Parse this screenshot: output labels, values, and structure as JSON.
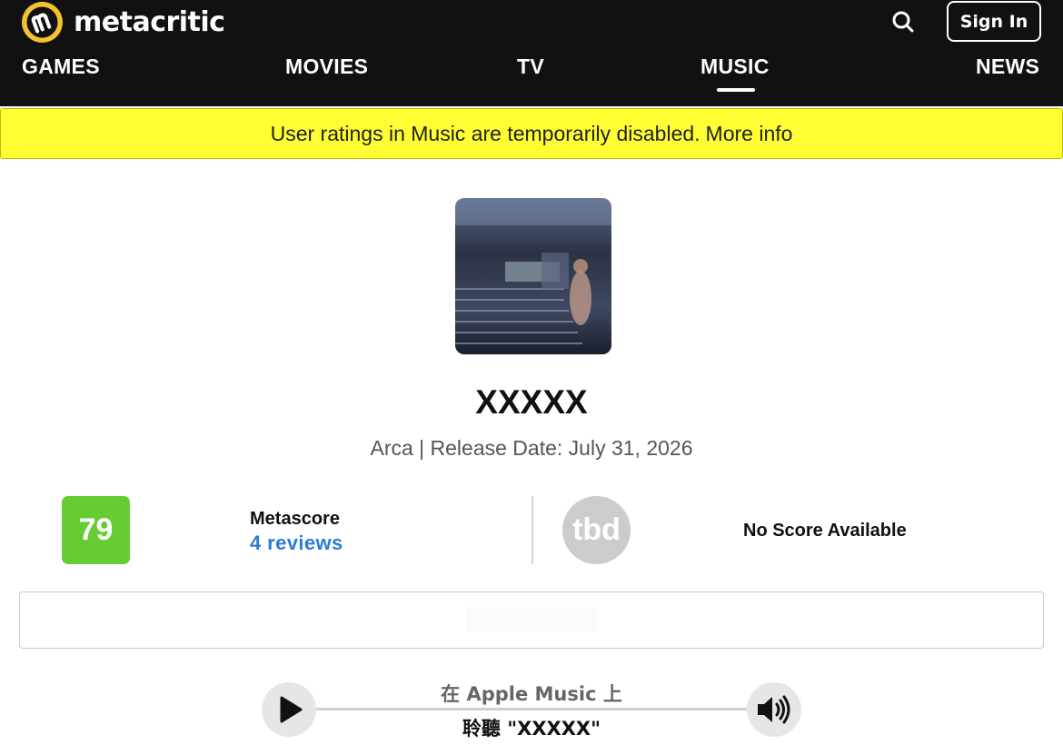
{
  "header": {
    "logo_text": "metacritic",
    "sign_in_label": "Sign In",
    "search_icon": "search-icon",
    "nav": [
      "GAMES",
      "MOVIES",
      "TV",
      "MUSIC",
      "NEWS"
    ],
    "active_nav": "MUSIC"
  },
  "banner": {
    "message": "User ratings in Music are temporarily disabled.",
    "link_label": "More info"
  },
  "album": {
    "title": "XXXXX",
    "subtitle": "Arca | Release Date: July 31, 2026"
  },
  "scores": {
    "metascore_value": "79",
    "metascore_label": "Metascore",
    "reviews_label": "4 reviews",
    "user_score_value": "tbd",
    "user_score_text": "No Score Available",
    "metascore_color": "#66cc33",
    "tbd_color": "#cccccc"
  },
  "player": {
    "line1": "在 Apple Music 上",
    "line2": "聆聽 \"XXXXX\"",
    "play_icon": "play-icon",
    "volume_icon": "volume-icon"
  },
  "colors": {
    "header_bg": "#111111",
    "banner_bg": "#ffff33",
    "logo_accent": "#f2c230",
    "link_blue": "#2b7bd6"
  }
}
